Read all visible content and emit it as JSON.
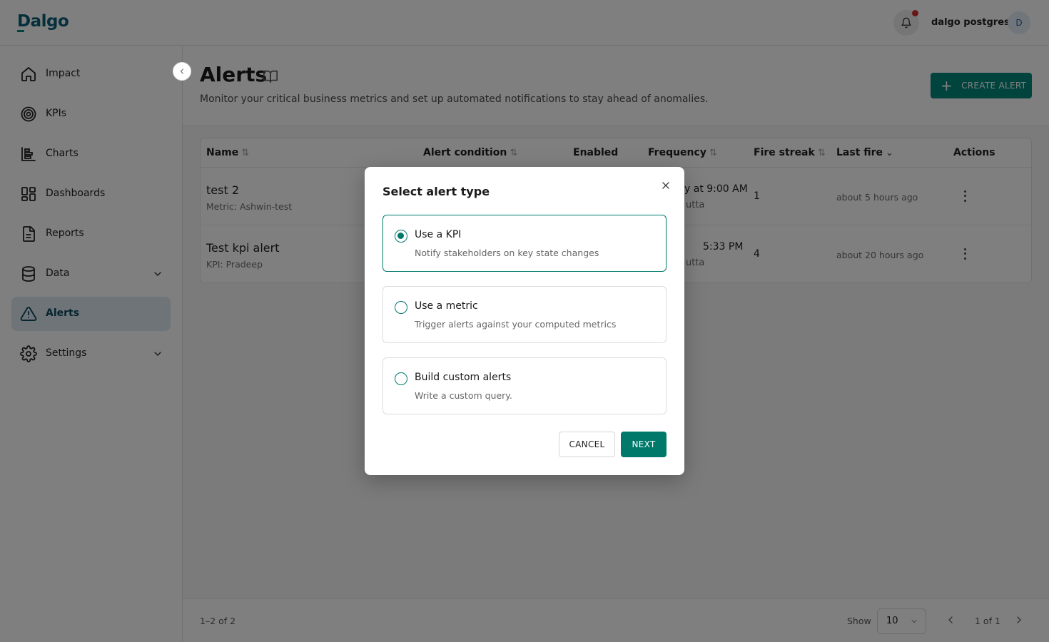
{
  "header": {
    "logo_text": "Dalgo",
    "username": "dalgo postgres",
    "avatar_initial": "D"
  },
  "sidebar": {
    "items": [
      {
        "label": "Impact",
        "icon": "home-icon"
      },
      {
        "label": "KPIs",
        "icon": "target-icon"
      },
      {
        "label": "Charts",
        "icon": "bar-chart-icon"
      },
      {
        "label": "Dashboards",
        "icon": "dashboard-grid-icon"
      },
      {
        "label": "Reports",
        "icon": "document-icon"
      },
      {
        "label": "Data",
        "icon": "database-icon",
        "expandable": true
      },
      {
        "label": "Alerts",
        "icon": "alert-triangle-icon",
        "active": true
      },
      {
        "label": "Settings",
        "icon": "gear-icon",
        "expandable": true
      }
    ]
  },
  "page": {
    "title": "Alerts",
    "subtitle": "Monitor your critical business metrics and set up automated notifications to stay ahead of anomalies.",
    "create_button": "CREATE ALERT"
  },
  "table": {
    "columns": [
      "Name",
      "Alert condition",
      "Enabled",
      "Frequency",
      "Fire streak",
      "Last fire",
      "Actions"
    ],
    "rows": [
      {
        "name": "test 2",
        "sub": "Metric: Ashwin-test",
        "frequency": "y at 9:00 AM",
        "frequency_sub": "utta",
        "fire_streak": "1",
        "last_fire": "about 5 hours ago"
      },
      {
        "name": "Test kpi alert",
        "sub": "KPI: Pradeep",
        "frequency": "5:33 PM",
        "frequency_sub": "utta",
        "fire_streak": "4",
        "last_fire": "about 20 hours ago"
      }
    ]
  },
  "footer": {
    "count": "1–2 of 2",
    "show_label": "Show",
    "page_size": "10",
    "page_info": "1 of 1"
  },
  "modal": {
    "title": "Select alert type",
    "options": [
      {
        "title": "Use a KPI",
        "description": "Notify stakeholders on key state changes",
        "selected": true
      },
      {
        "title": "Use a metric",
        "description": "Trigger alerts against your computed metrics",
        "selected": false
      },
      {
        "title": "Build custom alerts",
        "description": "Write a custom query.",
        "selected": false
      }
    ],
    "cancel_label": "CANCEL",
    "next_label": "NEXT"
  },
  "colors": {
    "accent": "#00897b",
    "active_nav_bg": "#dde8ee",
    "notification_dot": "#d32f2f"
  }
}
